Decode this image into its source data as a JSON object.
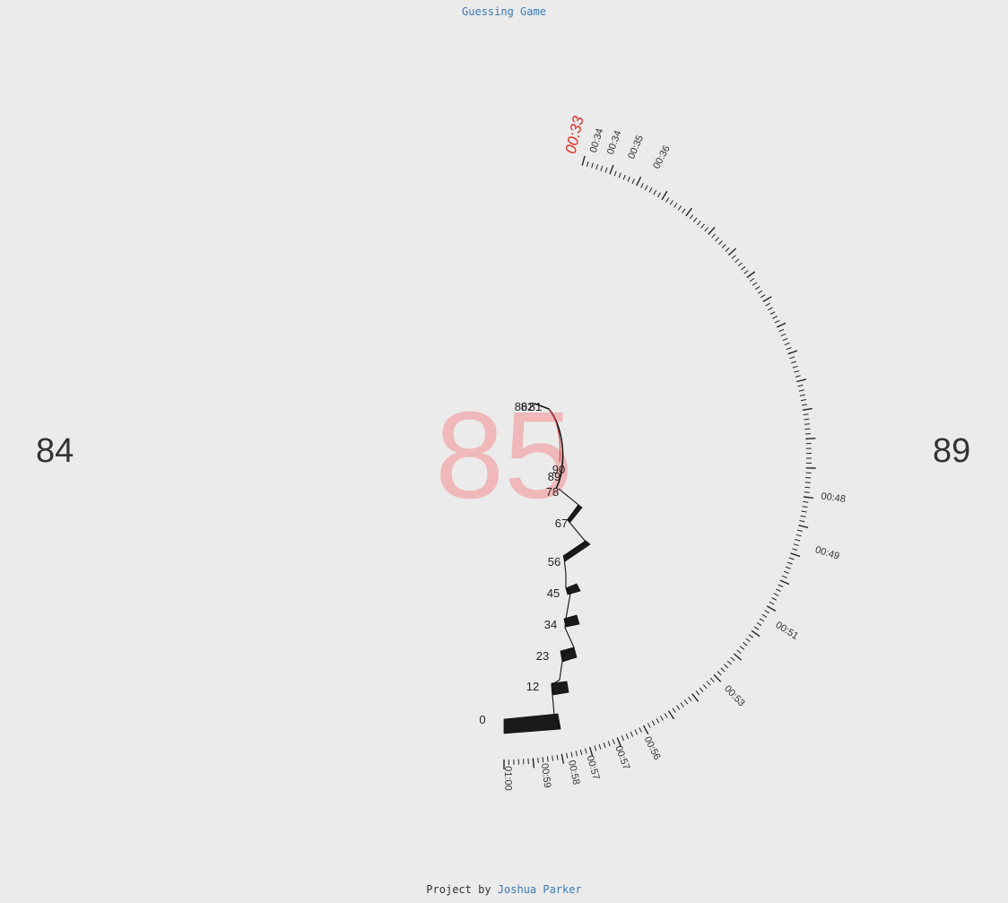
{
  "header": {
    "title": "Guessing Game"
  },
  "game": {
    "current_guess": "85",
    "lower_bound": "84",
    "upper_bound": "89",
    "colors": {
      "guess_number": "#f0b8b8",
      "current_time": "#e8251f",
      "text": "#333333",
      "link": "#3a7ab8"
    }
  },
  "timer": {
    "current_label": "00:33",
    "labels": [
      "00:34",
      "00:34",
      "00:35",
      "00:36",
      "00:48",
      "00:49",
      "00:51",
      "00:53",
      "00:56",
      "00:57",
      "00:57",
      "00:58",
      "00:59",
      "01:00"
    ]
  },
  "guess_path": {
    "labels": [
      "0",
      "12",
      "23",
      "34",
      "45",
      "56",
      "67",
      "78",
      "89",
      "90",
      "86",
      "82",
      "81"
    ]
  },
  "footer": {
    "prefix": "Project by",
    "author": "Joshua Parker"
  }
}
